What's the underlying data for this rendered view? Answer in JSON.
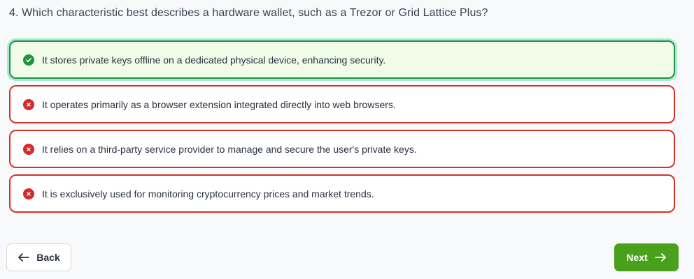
{
  "question": {
    "text": "4. Which characteristic best describes a hardware wallet, such as a Trezor or Grid Lattice Plus?"
  },
  "options": [
    {
      "text": "It stores private keys offline on a dedicated physical device, enhancing security.",
      "status": "correct",
      "icon": "check-circle-icon"
    },
    {
      "text": "It operates primarily as a browser extension integrated directly into web browsers.",
      "status": "incorrect",
      "icon": "x-circle-icon"
    },
    {
      "text": "It relies on a third-party service provider to manage and secure the user's private keys.",
      "status": "incorrect",
      "icon": "x-circle-icon"
    },
    {
      "text": "It is exclusively used for monitoring cryptocurrency prices and market trends.",
      "status": "incorrect",
      "icon": "x-circle-icon"
    }
  ],
  "nav": {
    "back_label": "Back",
    "back_icon": "arrow-left-icon",
    "next_label": "Next",
    "next_icon": "arrow-right-icon"
  },
  "colors": {
    "correct_border": "#22934a",
    "correct_bg": "#f0fbe8",
    "incorrect_border": "#d3322b",
    "next_button": "#4aa01a"
  }
}
